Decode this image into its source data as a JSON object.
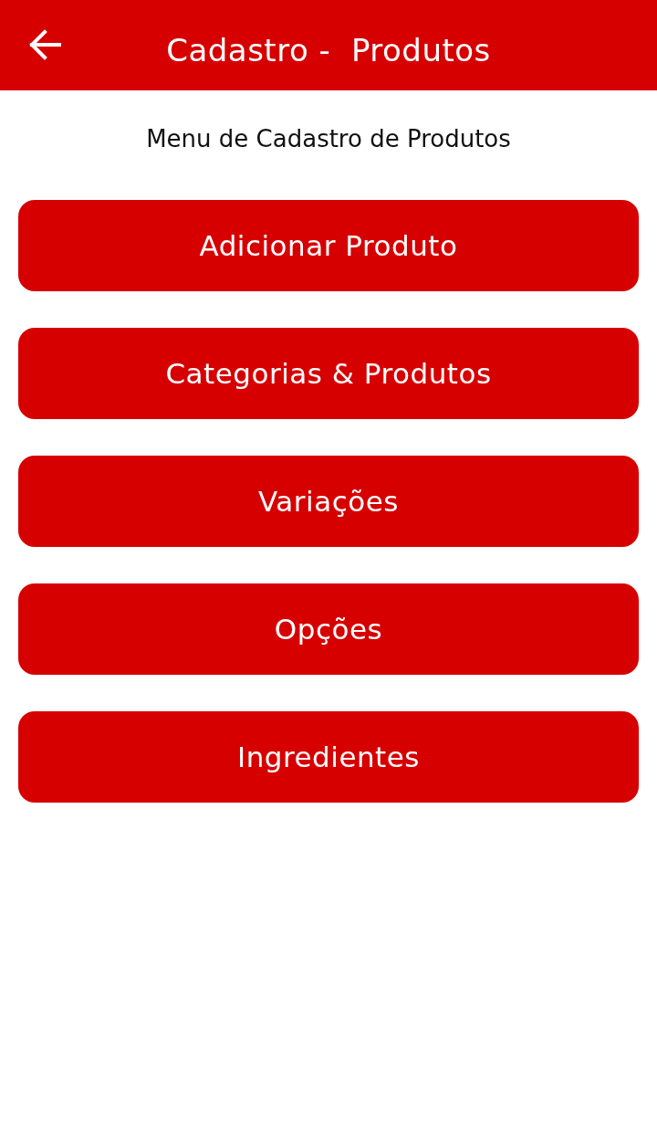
{
  "app_bar": {
    "title": "Cadastro -  Produtos"
  },
  "subtitle": "Menu de Cadastro de Produtos",
  "buttons": [
    {
      "label": "Adicionar Produto"
    },
    {
      "label": "Categorias & Produtos"
    },
    {
      "label": "Variações"
    },
    {
      "label": "Opções"
    },
    {
      "label": "Ingredientes"
    }
  ]
}
